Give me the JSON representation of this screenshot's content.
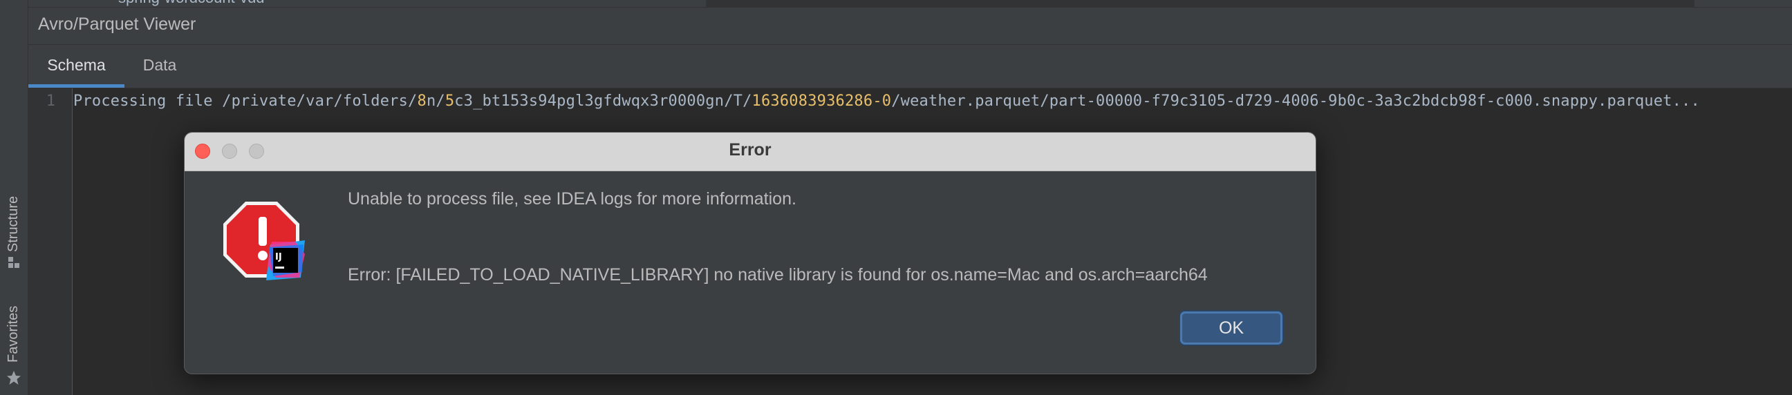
{
  "top_strip": {
    "clipped_text": "spring-wordcount-vdd"
  },
  "left_strip": {
    "structure_label": "Structure",
    "favorites_label": "Favorites"
  },
  "tool_window": {
    "title": "Avro/Parquet Viewer",
    "tabs": [
      {
        "label": "Schema",
        "active": true
      },
      {
        "label": "Data",
        "active": false
      }
    ]
  },
  "editor": {
    "line_number": "1",
    "line": {
      "p1": "Processing file /private/var/folders/",
      "n1": "8",
      "p2": "n/",
      "n2": "5",
      "p3": "c3_bt153s94pgl3gfdwqx3r0000gn/T/",
      "n3": "1636083936286-0",
      "p4": "/weather.parquet/part-00000-f79c3105-d729-4006-9b0c-3a3c2bdcb98f-c000.snappy.parquet..."
    }
  },
  "dialog": {
    "title": "Error",
    "message": "Unable to process file, see IDEA logs for more information.",
    "detail": "Error: [FAILED_TO_LOAD_NATIVE_LIBRARY] no native library is found for os.name=Mac and os.arch=aarch64",
    "ok_label": "OK",
    "icon": "error-stop-icon",
    "badge_text": "IJ"
  },
  "colors": {
    "background": "#2b2b2b",
    "panel": "#3c3f41",
    "accent": "#4a88c7",
    "number_highlight": "#e8bf6a",
    "error_red": "#e0262b"
  }
}
